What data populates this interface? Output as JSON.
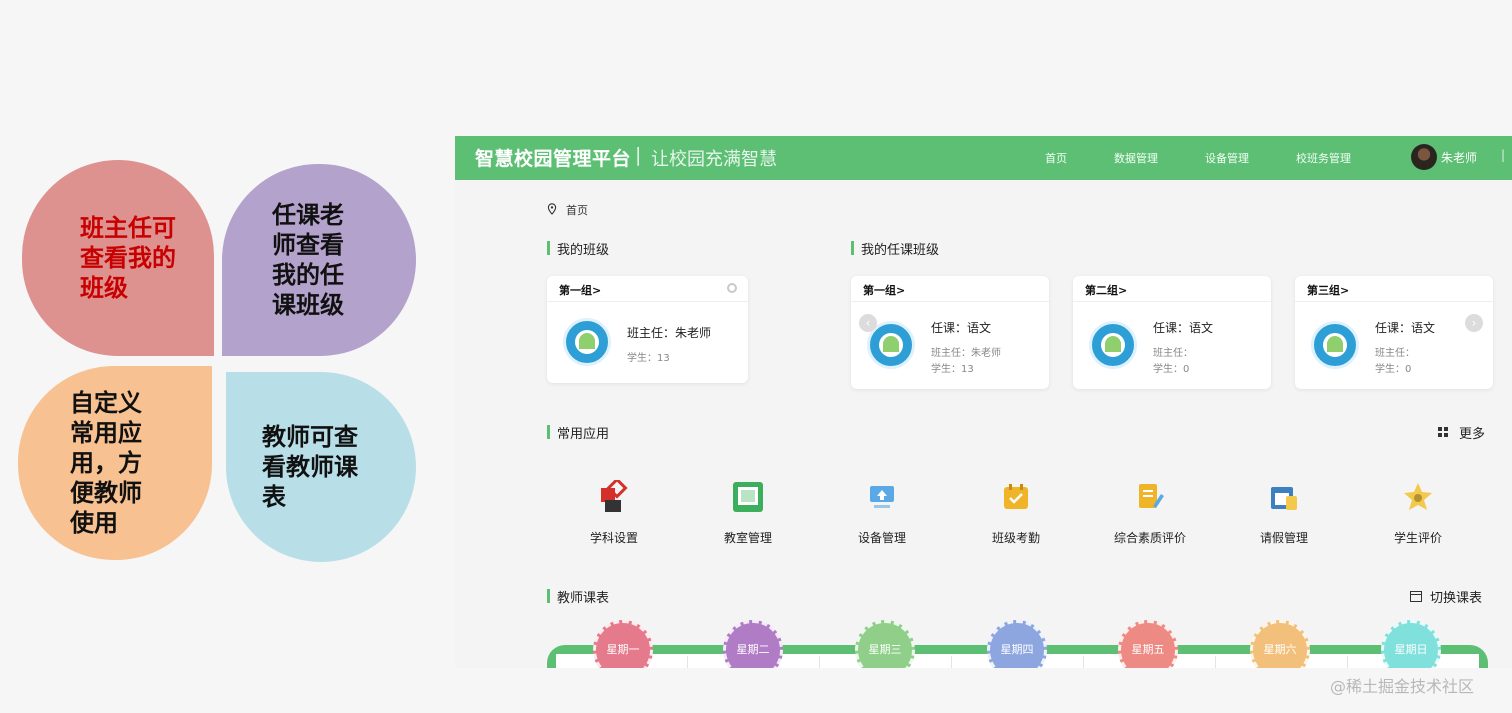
{
  "petals": [
    {
      "text": "班主任可\n查看我的\n班级"
    },
    {
      "text": "任课老\n师查看\n我的任\n课班级"
    },
    {
      "text": "自定义\n常用应\n用，方\n便教师\n使用"
    },
    {
      "text": "教师可查\n看教师课\n表"
    }
  ],
  "header": {
    "brand": "智慧校园管理平台",
    "separator": "|",
    "slogan": "让校园充满智慧",
    "nav": [
      "首页",
      "数据管理",
      "设备管理",
      "校班务管理"
    ],
    "user": "朱老师",
    "end": "|"
  },
  "breadcrumb": "首页",
  "my_class": {
    "title": "我的班级",
    "card": {
      "group": "第一组>",
      "line1": "班主任：朱老师",
      "line2": "学生：13"
    }
  },
  "teaching": {
    "title": "我的任课班级",
    "cards": [
      {
        "group": "第一组>",
        "line1": "任课：语文",
        "line2": "班主任：朱老师",
        "line3": "学生：13"
      },
      {
        "group": "第二组>",
        "line1": "任课：语文",
        "line2": "班主任：",
        "line3": "学生：0"
      },
      {
        "group": "第三组>",
        "line1": "任课：语文",
        "line2": "班主任：",
        "line3": "学生：0"
      }
    ]
  },
  "apps": {
    "title": "常用应用",
    "more": "更多",
    "items": [
      {
        "label": "学科设置",
        "icon": "subject-icon",
        "color": "#d4302b"
      },
      {
        "label": "教室管理",
        "icon": "classroom-icon",
        "color": "#3cae5c"
      },
      {
        "label": "设备管理",
        "icon": "device-icon",
        "color": "#5aa9e6"
      },
      {
        "label": "班级考勤",
        "icon": "attendance-icon",
        "color": "#f0b429"
      },
      {
        "label": "综合素质评价",
        "icon": "evaluation-icon",
        "color": "#f0b429"
      },
      {
        "label": "请假管理",
        "icon": "leave-icon",
        "color": "#3d7fc1"
      },
      {
        "label": "学生评价",
        "icon": "student-eval-icon",
        "color": "#f2c94c"
      }
    ]
  },
  "schedule": {
    "title": "教师课表",
    "switch": "切换课表",
    "days": [
      {
        "label": "星期一",
        "color": "#e57a8c"
      },
      {
        "label": "星期二",
        "color": "#b07cc6"
      },
      {
        "label": "星期三",
        "color": "#8fcf8a"
      },
      {
        "label": "星期四",
        "color": "#8ea6e0"
      },
      {
        "label": "星期五",
        "color": "#ee8a84"
      },
      {
        "label": "星期六",
        "color": "#f2c07a"
      },
      {
        "label": "星期日",
        "color": "#7fe0dc"
      }
    ]
  },
  "watermark": "@稀土掘金技术社区"
}
